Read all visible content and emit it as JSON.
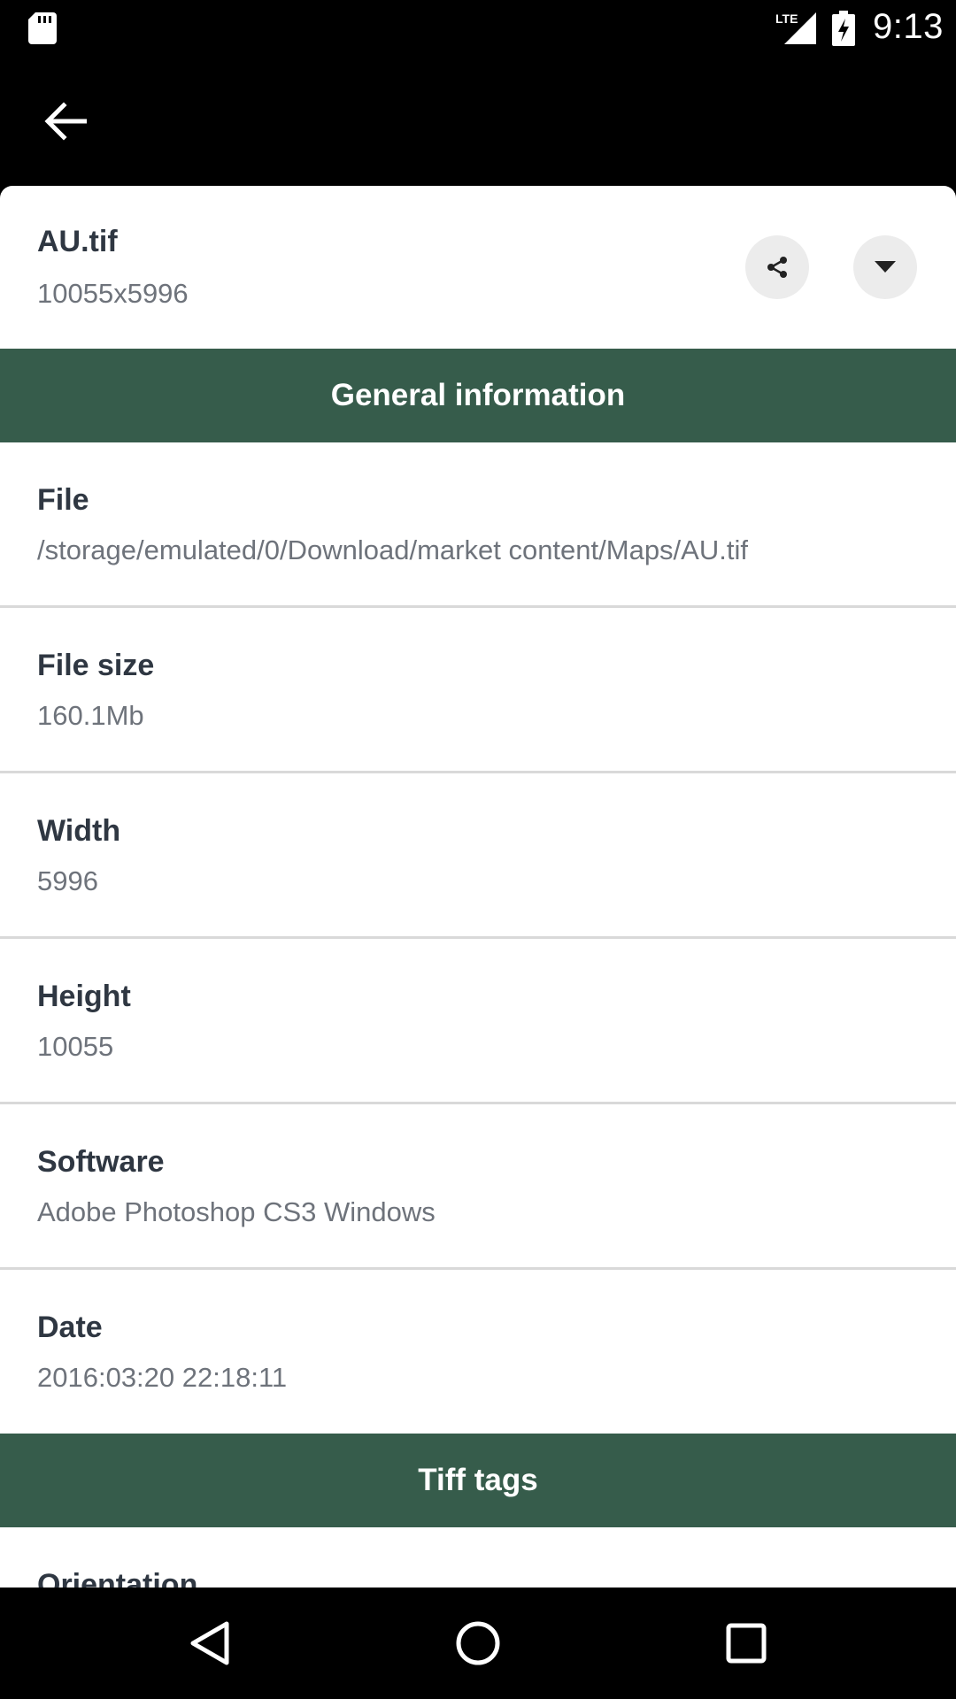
{
  "status_bar": {
    "time": "9:13",
    "network": "LTE",
    "icons": [
      "sd-card-icon",
      "lte-signal-icon",
      "battery-charging-icon"
    ]
  },
  "toolbar": {
    "back_icon": "arrow-back-icon"
  },
  "header": {
    "title": "AU.tif",
    "dimensions": "10055x5996",
    "share_icon": "share-icon",
    "expand_icon": "caret-down-icon"
  },
  "sections": {
    "general": "General information",
    "tiff": "Tiff tags"
  },
  "rows": [
    {
      "label": "File",
      "value": "/storage/emulated/0/Download/market content/Maps/AU.tif"
    },
    {
      "label": "File size",
      "value": "160.1Mb"
    },
    {
      "label": "Width",
      "value": "5996"
    },
    {
      "label": "Height",
      "value": "10055"
    },
    {
      "label": "Software",
      "value": "Adobe Photoshop CS3 Windows"
    },
    {
      "label": "Date",
      "value": "2016:03:20 22:18:11"
    }
  ],
  "partial_row_label": "Orientation",
  "nav": {
    "back": "nav-back-icon",
    "home": "nav-home-icon",
    "recents": "nav-recents-icon"
  },
  "colors": {
    "section_bg": "#365c4b",
    "label": "#2f3742",
    "value": "#6e737b"
  }
}
